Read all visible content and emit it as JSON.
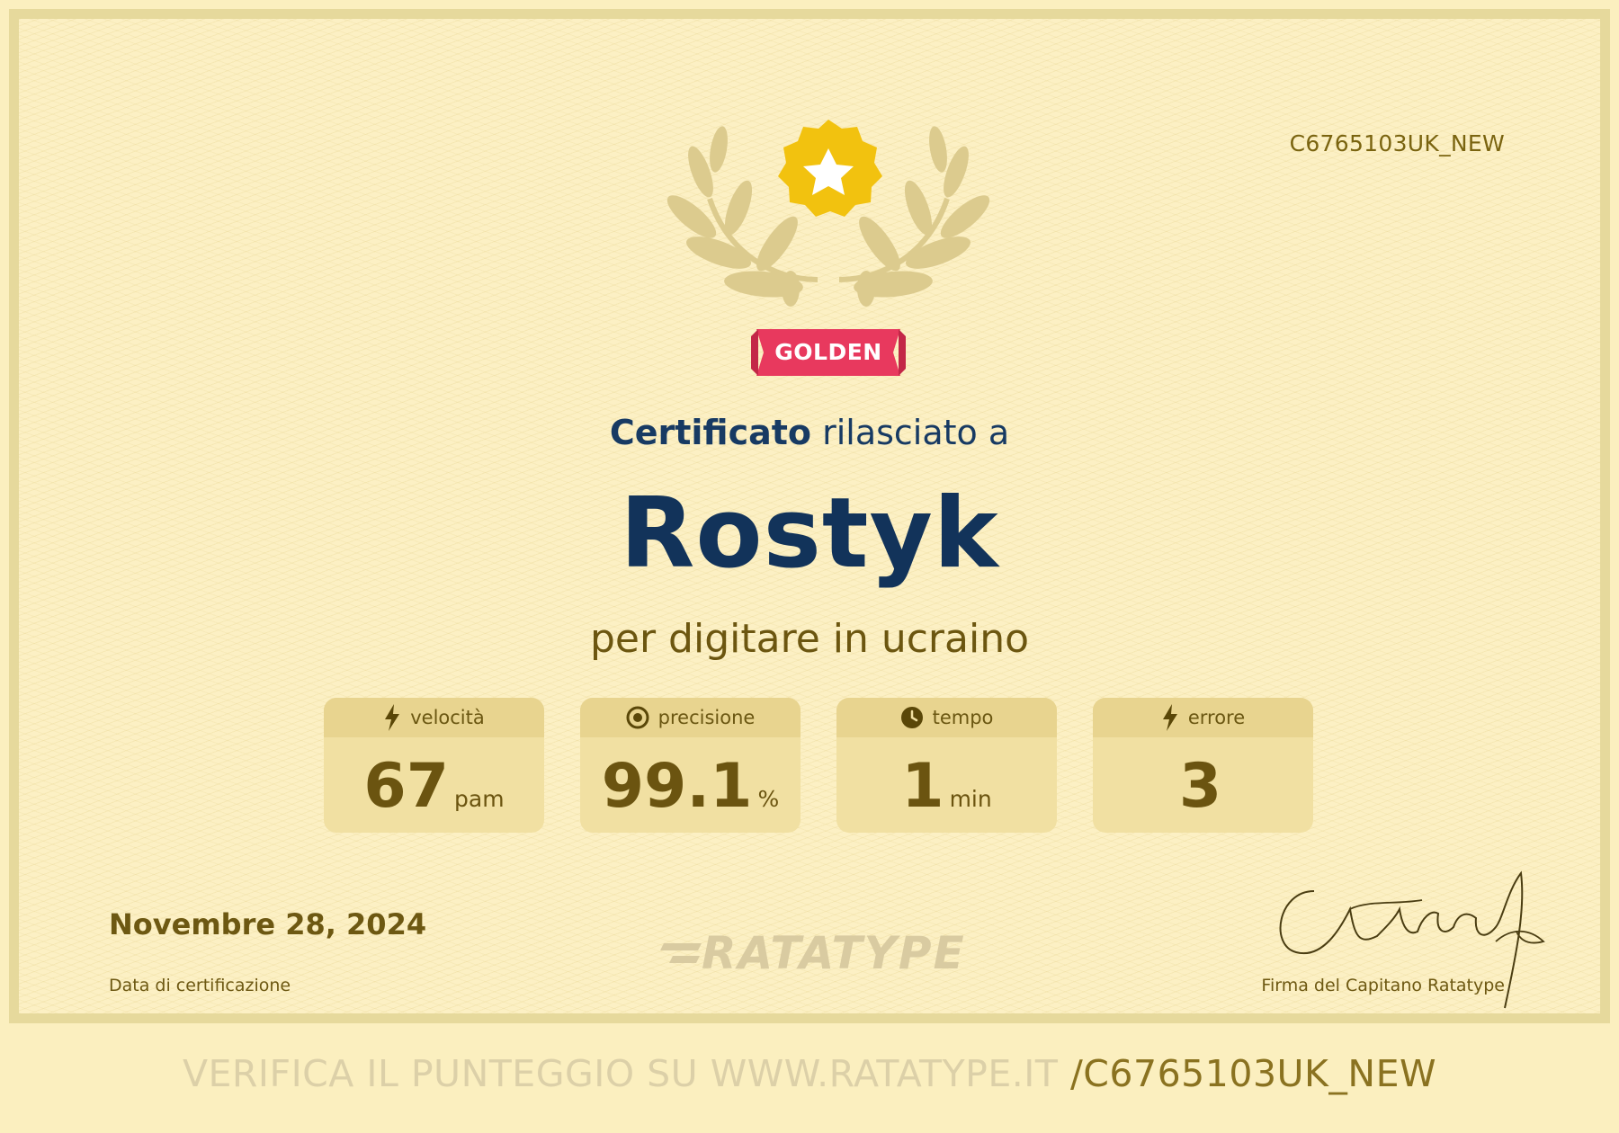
{
  "certificate": {
    "id": "C6765103UK_NEW",
    "badge": "GOLDEN",
    "issued_bold": "Certificato",
    "issued_rest": " rilasciato a",
    "name": "Rostyk",
    "subtitle": "per digitare in ucraino",
    "date": "Novembre 28, 2024",
    "date_label": "Data di certificazione",
    "logo": "RATATYPE",
    "signature_label": "Firma del Capitano Ratatype"
  },
  "stats": [
    {
      "icon": "lightning-icon",
      "label": "velocità",
      "value": "67",
      "unit": "pam"
    },
    {
      "icon": "target-icon",
      "label": "precisione",
      "value": "99.1",
      "unit": "%"
    },
    {
      "icon": "clock-icon",
      "label": "tempo",
      "value": "1",
      "unit": "min"
    },
    {
      "icon": "lightning-icon",
      "label": "errore",
      "value": "3",
      "unit": ""
    }
  ],
  "footer": {
    "verify_prefix": "VERIFICA IL PUNTEGGIO SU WWW.RATATYPE.IT ",
    "verify_code": "/C6765103UK_NEW"
  },
  "colors": {
    "background": "#fcf0c4",
    "border": "#e6d99c",
    "navy": "#12335a",
    "gold_text": "#6b5410",
    "badge_red": "#e8395e",
    "star_gold": "#f2c20f"
  }
}
